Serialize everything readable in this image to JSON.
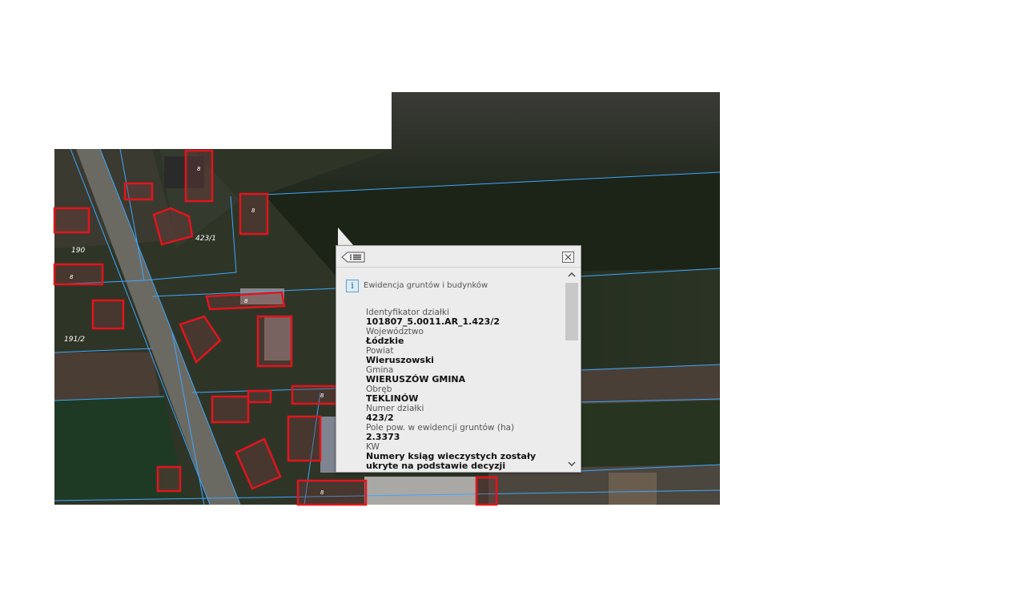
{
  "map": {
    "parcel_labels": [
      "423/1",
      "190",
      "191/2"
    ],
    "building_labels": [
      "8",
      "8",
      "8",
      "8",
      "8",
      "8"
    ],
    "colors": {
      "parcel_line": "#3fa6ff",
      "building_outline": "#e3141c",
      "field_dark": "#1d2418",
      "field_light": "#4a3d33"
    }
  },
  "popup": {
    "back_icon": "list-back-icon",
    "close_icon": "close-icon",
    "layer_icon": "info-icon",
    "info_glyph": "i",
    "layer_title": "Ewidencja gruntów i budynków",
    "fields": [
      {
        "label": "Identyfikator działki",
        "value": "101807_5.0011.AR_1.423/2"
      },
      {
        "label": "Województwo",
        "value": "Łódzkie"
      },
      {
        "label": "Powiat",
        "value": "Wieruszowski"
      },
      {
        "label": "Gmina",
        "value": "WIERUSZÓW GMINA"
      },
      {
        "label": "Obręb",
        "value": "TEKLINÓW"
      },
      {
        "label": "Numer działki",
        "value": "423/2"
      },
      {
        "label": "Pole pow. w ewidencji gruntów (ha)",
        "value": "2.3373"
      },
      {
        "label": "KW",
        "value": "Numery ksiąg wieczystych zostały ukryte na podstawie decyzji"
      }
    ]
  }
}
